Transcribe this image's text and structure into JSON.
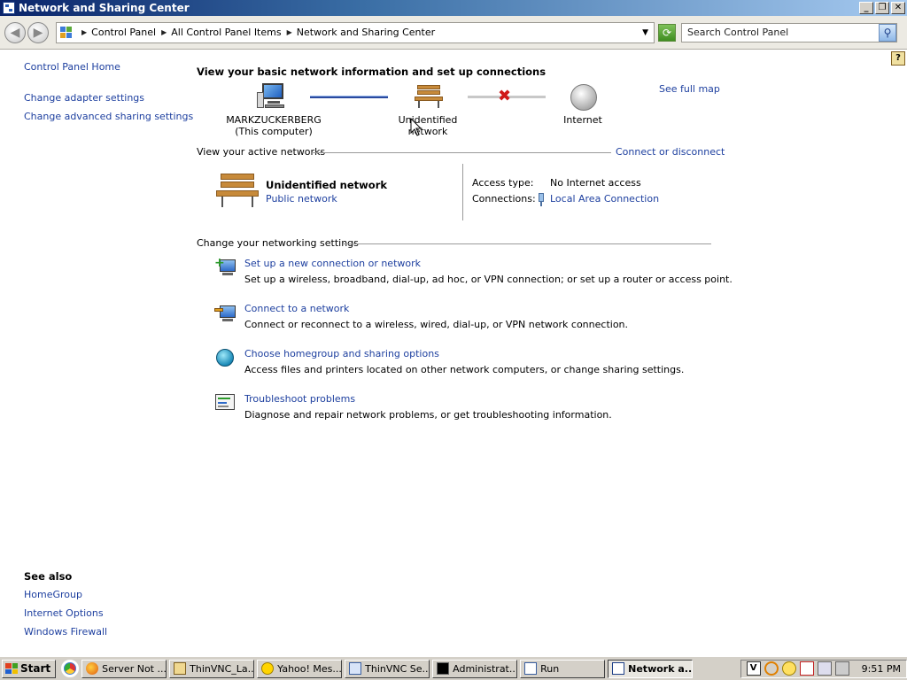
{
  "window": {
    "title": "Network and Sharing Center",
    "controls": {
      "minimize": "_",
      "restore": "❐",
      "close": "✕"
    }
  },
  "addressbar": {
    "crumbs": [
      "Control Panel",
      "All Control Panel Items",
      "Network and Sharing Center"
    ],
    "search_placeholder": "Search Control Panel"
  },
  "leftpane": {
    "home": "Control Panel Home",
    "links": [
      "Change adapter settings",
      "Change advanced sharing settings"
    ],
    "see_also_heading": "See also",
    "see_also": [
      "HomeGroup",
      "Internet Options",
      "Windows Firewall"
    ]
  },
  "main": {
    "heading": "View your basic network information and set up connections",
    "see_full_map": "See full map",
    "map": {
      "computer_name": "MARKZUCKERBERG",
      "computer_sub": "(This computer)",
      "network_name": "Unidentified network",
      "internet": "Internet"
    },
    "active_networks_label": "View your active networks",
    "connect_or_disconnect": "Connect or disconnect",
    "active": {
      "name": "Unidentified network",
      "type": "Public network",
      "access_type_label": "Access type:",
      "access_type_value": "No Internet access",
      "connections_label": "Connections:",
      "connections_value": "Local Area Connection"
    },
    "settings_label": "Change your networking settings",
    "tasks": [
      {
        "title": "Set up a new connection or network",
        "desc": "Set up a wireless, broadband, dial-up, ad hoc, or VPN connection; or set up a router or access point.",
        "icon": "new-connection-icon"
      },
      {
        "title": "Connect to a network",
        "desc": "Connect or reconnect to a wireless, wired, dial-up, or VPN network connection.",
        "icon": "connect-network-icon"
      },
      {
        "title": "Choose homegroup and sharing options",
        "desc": "Access files and printers located on other network computers, or change sharing settings.",
        "icon": "homegroup-icon"
      },
      {
        "title": "Troubleshoot problems",
        "desc": "Diagnose and repair network problems, or get troubleshooting information.",
        "icon": "troubleshoot-icon"
      }
    ]
  },
  "taskbar": {
    "start": "Start",
    "buttons": [
      "Server Not ...",
      "ThinVNC_La...",
      "Yahoo! Mes...",
      "ThinVNC Se...",
      "Administrat...",
      "Run",
      "Network a..."
    ],
    "clock": "9:51 PM"
  },
  "colors": {
    "link": "#1d3f9f",
    "titlebar_start": "#0a246a",
    "taskbar": "#d4d0c8",
    "error": "#d01818"
  }
}
